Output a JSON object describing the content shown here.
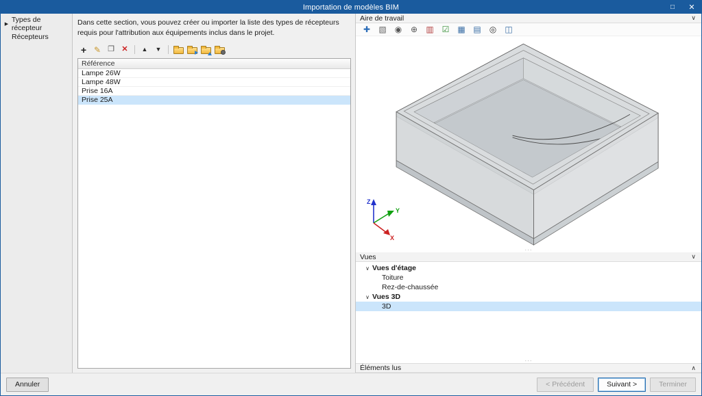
{
  "window": {
    "title": "Importation de modèles BIM",
    "maximize_glyph": "□",
    "close_glyph": "✕"
  },
  "sidebar": {
    "selected_arrow": "▶",
    "items": [
      {
        "label": "Types de récepteur"
      },
      {
        "label": "Récepteurs"
      }
    ]
  },
  "main": {
    "description": "Dans cette section, vous pouvez créer ou importer la liste des types de récepteurs requis pour l'attribution aux équipements inclus dans le projet.",
    "toolbar": {
      "add_icon": "+",
      "edit_icon": "✎",
      "copy_icon": "❐",
      "delete_icon": "✕",
      "up_icon": "▲",
      "down_icon": "▼"
    },
    "table": {
      "header": "Référence",
      "rows": [
        "Lampe 26W",
        "Lampe 48W",
        "Prise 16A",
        "Prise 25A"
      ],
      "selected_row": "Prise 25A"
    }
  },
  "right": {
    "workspace": {
      "title": "Aire de travail",
      "chevron": "∨"
    },
    "toolbar": [
      {
        "glyph": "✚",
        "style": "color:#2b6cb8"
      },
      {
        "glyph": "▧",
        "style": "color:#666666"
      },
      {
        "glyph": "◉",
        "style": "color:#555555"
      },
      {
        "glyph": "⊕",
        "style": "color:#555555"
      },
      {
        "glyph": "▥",
        "style": "color:#b34040"
      },
      {
        "glyph": "☑",
        "style": "color:#2e8b2e"
      },
      {
        "glyph": "▦",
        "style": "color:#3a6ea5"
      },
      {
        "glyph": "▤",
        "style": "color:#3a6ea5"
      },
      {
        "glyph": "◎",
        "style": "color:#333333"
      },
      {
        "glyph": "◫",
        "style": "color:#3a6ea5"
      }
    ],
    "axes": {
      "x_label": "X",
      "y_label": "Y",
      "z_label": "Z",
      "x_color": "#cc2222",
      "y_color": "#11a011",
      "z_color": "#2233cc"
    },
    "views": {
      "title": "Vues",
      "chevron": "∨",
      "groups": [
        {
          "expander": "∨",
          "label": "Vues d'étage",
          "children": [
            "Toiture",
            "Rez-de-chaussée"
          ]
        },
        {
          "expander": "∨",
          "label": "Vues 3D",
          "children": [
            "3D"
          ]
        }
      ],
      "selected": "3D"
    },
    "elements": {
      "title": "Éléments lus",
      "chevron": "∧"
    },
    "splitter_dots": "···"
  },
  "footer": {
    "cancel_label": "Annuler",
    "previous_label": "< Précédent",
    "next_label": "Suivant >",
    "finish_label": "Terminer"
  },
  "colors": {
    "titlebar": "#1a5b9e",
    "selection": "#cbe5fb"
  }
}
